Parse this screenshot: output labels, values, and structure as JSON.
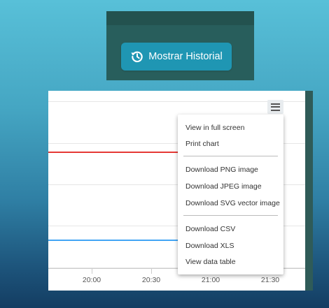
{
  "header": {
    "history_button_label": "Mostrar Historial"
  },
  "chart": {
    "x_tick_labels": [
      "20:00",
      "20:30",
      "21:00",
      "21:30"
    ],
    "series_colors": [
      "#e53935",
      "#42a5f5"
    ]
  },
  "export_menu": {
    "items": [
      "View in full screen",
      "Print chart",
      "Download PNG image",
      "Download JPEG image",
      "Download SVG vector image",
      "Download CSV",
      "Download XLS",
      "View data table"
    ]
  },
  "colors": {
    "button_bg": "#1f96b3",
    "panel_bg": "#285e5c"
  },
  "icons": {
    "history": "history-icon",
    "menu": "hamburger-icon"
  }
}
